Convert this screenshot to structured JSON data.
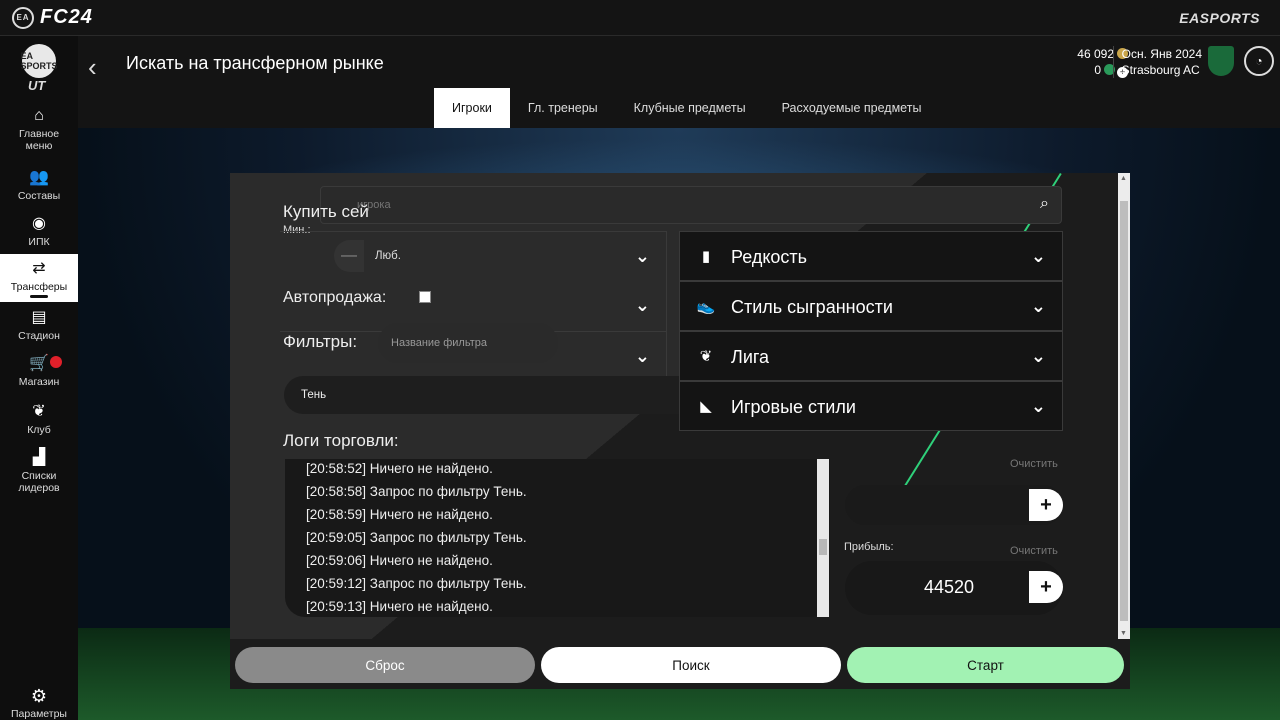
{
  "app": {
    "logo": "FC24",
    "ea_badge": "EA",
    "publisher": "EASPORTS",
    "ut_logo_badge": "EA SPORTS",
    "ut_logo": "UT"
  },
  "nav": [
    {
      "label": "Главное меню",
      "icon": "home-icon"
    },
    {
      "label": "Составы",
      "icon": "squad-icon"
    },
    {
      "label": "ИПК",
      "icon": "sbc-icon"
    },
    {
      "label": "Трансферы",
      "icon": "transfers-icon",
      "active": true
    },
    {
      "label": "Стадион",
      "icon": "stadium-icon"
    },
    {
      "label": "Магазин",
      "icon": "cart-icon",
      "badge": true
    },
    {
      "label": "Клуб",
      "icon": "club-icon"
    },
    {
      "label": "Списки лидеров",
      "icon": "leaderboard-icon"
    }
  ],
  "settings_label": "Параметры",
  "header": {
    "title": "Искать на трансферном рынке",
    "coins": "46 092",
    "points": "0",
    "season": "Осн. Янв 2024",
    "club": "Strasbourg AC"
  },
  "tabs": [
    "Игроки",
    "Гл. тренеры",
    "Клубные предметы",
    "Расходуемые предметы"
  ],
  "panel": {
    "search_placeholder": "игрока",
    "buy_label": "Купить сей",
    "min_label": "Мин.:",
    "any_value": "Люб.",
    "autosell_label": "Автопродажа:",
    "filters_label": "Фильтры:",
    "filter_name_placeholder": "Название фильтра",
    "filter_value": "Тень",
    "logs_label": "Логи торговли:",
    "logs": [
      "[20:58:52] Ничего не найдено.",
      "[20:58:58] Запрос по фильтру Тень.",
      "[20:58:59] Ничего не найдено.",
      "[20:59:05] Запрос по фильтру Тень.",
      "[20:59:06] Ничего не найдено.",
      "[20:59:12] Запрос по фильтру Тень.",
      "[20:59:13] Ничего не найдено."
    ],
    "dropdowns_right": [
      {
        "label": "Редкость",
        "icon": "rarity-icon"
      },
      {
        "label": "Стиль сыгранности",
        "icon": "boot-icon"
      },
      {
        "label": "Лига",
        "icon": "league-icon"
      },
      {
        "label": "Игровые стили",
        "icon": "playstyle-icon"
      }
    ],
    "clear_label": "Очистить",
    "profit_label": "Прибыль:",
    "profit_value": "44520",
    "buttons": {
      "reset": "Сброс",
      "search": "Поиск",
      "start": "Старт"
    }
  },
  "colors": {
    "accent_green": "#a2f2b3",
    "notify_red": "#e0202a",
    "coin_gold": "#c9a54a"
  }
}
